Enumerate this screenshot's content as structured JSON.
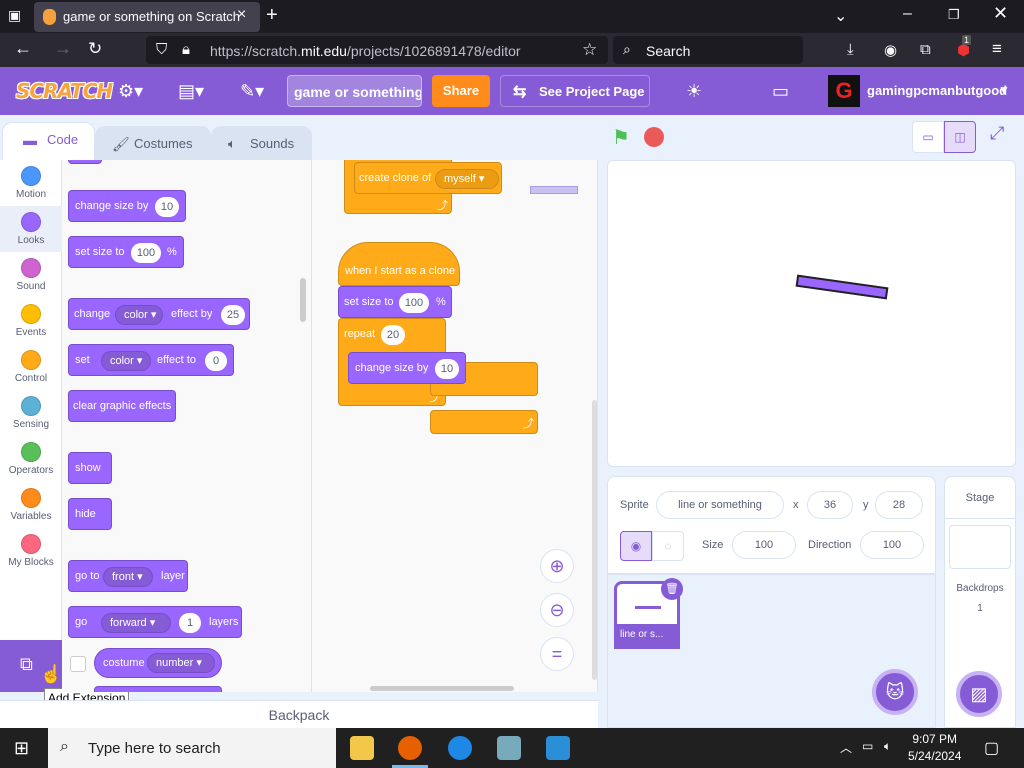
{
  "browser": {
    "tab_title": "game or something on Scratch",
    "url_prefix": "https://scratch.",
    "url_domain": "mit.edu",
    "url_path": "/projects/1026891478/editor",
    "search_placeholder": "Search",
    "notification_count": "1"
  },
  "menubar": {
    "logo": "SCRATCH",
    "project_title": "game or something",
    "share_label": "Share",
    "see_project_label": "See Project Page",
    "username": "gamingpcmanbutgood",
    "avatar_letter": "G"
  },
  "tabs": {
    "code": "Code",
    "costumes": "Costumes",
    "sounds": "Sounds"
  },
  "categories": [
    {
      "label": "Motion",
      "color": "#4c97ff"
    },
    {
      "label": "Looks",
      "color": "#9966ff"
    },
    {
      "label": "Sound",
      "color": "#cf63cf"
    },
    {
      "label": "Events",
      "color": "#ffbf00"
    },
    {
      "label": "Control",
      "color": "#ffab19"
    },
    {
      "label": "Sensing",
      "color": "#5cb1d6"
    },
    {
      "label": "Operators",
      "color": "#59c059"
    },
    {
      "label": "Variables",
      "color": "#ff8c1a"
    },
    {
      "label": "My Blocks",
      "color": "#ff6680"
    }
  ],
  "extension_tooltip": "Add Extension",
  "palette": {
    "change_size_by": "change size by",
    "change_size_value": "10",
    "set_size_to": "set size to",
    "set_size_value": "100",
    "percent": "%",
    "change": "change",
    "color": "color",
    "effect_by": "effect by",
    "effect_value": "25",
    "set": "set",
    "effect_to": "effect to",
    "set_effect_value": "0",
    "clear_graphic_effects": "clear graphic effects",
    "show": "show",
    "hide": "hide",
    "go_to": "go to",
    "front": "front",
    "layer": "layer",
    "go": "go",
    "forward": "forward",
    "layers_value": "1",
    "layers": "layers",
    "costume": "costume",
    "number": "number"
  },
  "script": {
    "create_clone_of": "create clone of",
    "myself": "myself",
    "when_i_start_as_clone": "when I start as a clone",
    "set_size_to": "set size to",
    "set_size_value": "100",
    "percent": "%",
    "repeat": "repeat",
    "repeat_value": "20",
    "change_size_by": "change size by",
    "change_size_value": "10"
  },
  "backpack": "Backpack",
  "sprite_info": {
    "sprite_label": "Sprite",
    "sprite_name": "line or something",
    "x_label": "x",
    "x_value": "36",
    "y_label": "y",
    "y_value": "28",
    "size_label": "Size",
    "size_value": "100",
    "direction_label": "Direction",
    "direction_value": "100"
  },
  "sprite_thumb_label": "line or s...",
  "stage_panel": {
    "title": "Stage",
    "backdrops_label": "Backdrops",
    "backdrops_count": "1"
  },
  "taskbar": {
    "search_placeholder": "Type here to search",
    "time": "9:07 PM",
    "date": "5/24/2024"
  },
  "colors": {
    "scratch_purple": "#855cd6",
    "looks": "#9966ff",
    "control": "#ffab19",
    "share": "#ff8c1a"
  }
}
